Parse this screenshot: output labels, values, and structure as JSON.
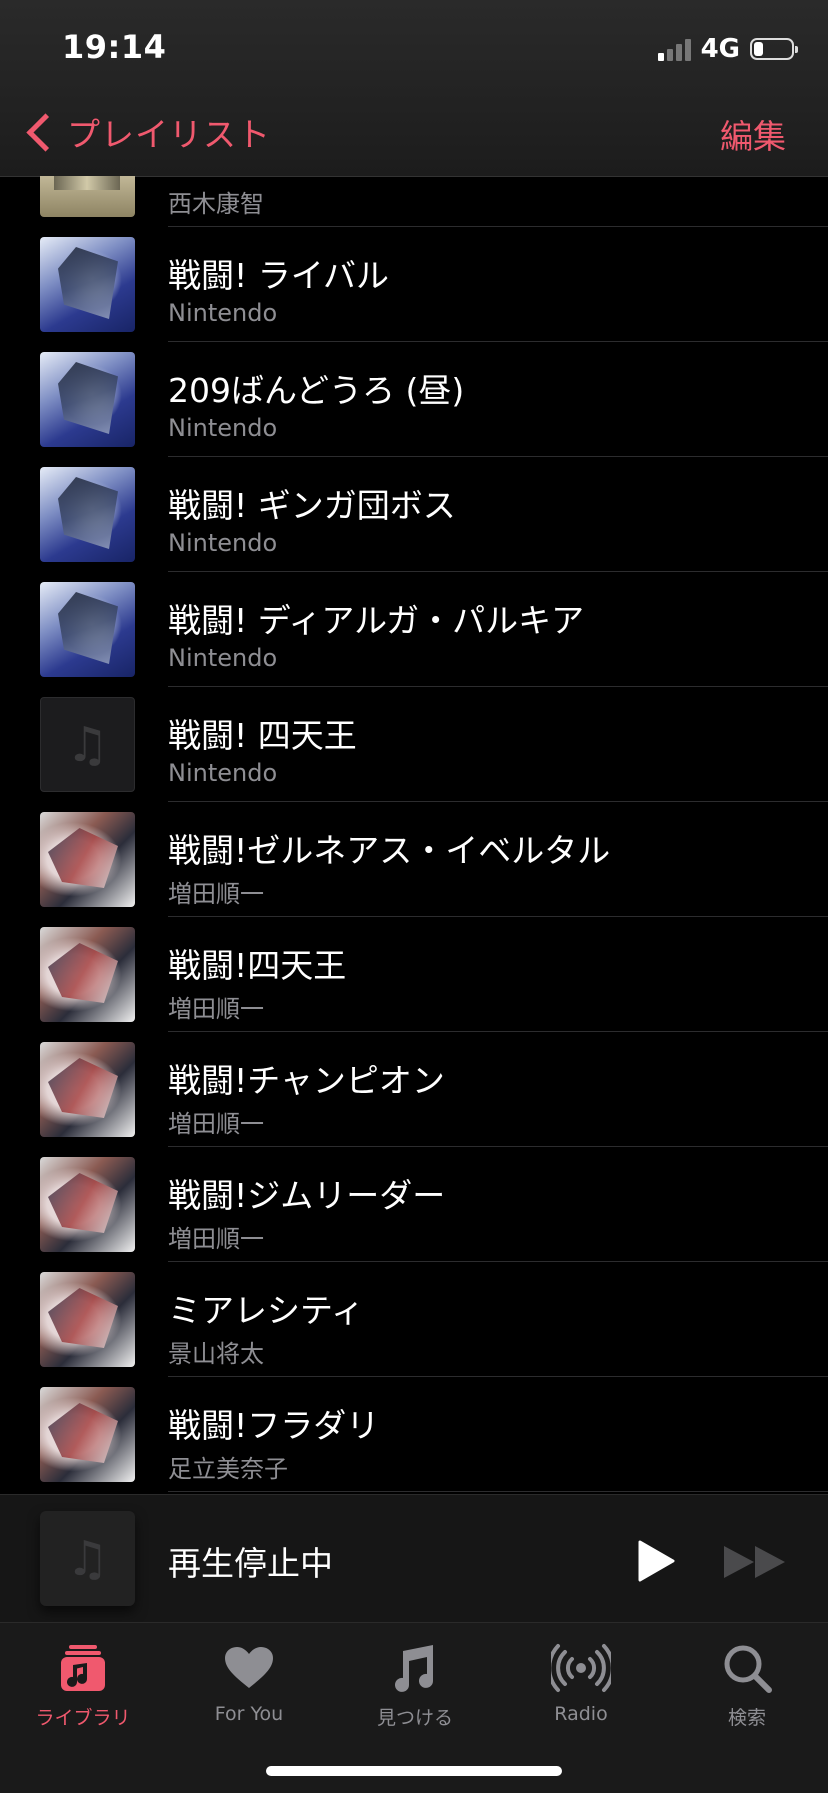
{
  "status": {
    "time": "19:14",
    "network": "4G",
    "battery_level": 0.25
  },
  "nav": {
    "back_label": "プレイリスト",
    "edit_label": "編集"
  },
  "tracks": [
    {
      "title": "",
      "artist": "西木康智",
      "art": "octo"
    },
    {
      "title": "戦闘! ライバル",
      "artist": "Nintendo",
      "art": "dialga"
    },
    {
      "title": "209ばんどうろ (昼)",
      "artist": "Nintendo",
      "art": "dialga"
    },
    {
      "title": "戦闘! ギンガ団ボス",
      "artist": "Nintendo",
      "art": "dialga"
    },
    {
      "title": "戦闘! ディアルガ・パルキア",
      "artist": "Nintendo",
      "art": "dialga"
    },
    {
      "title": "戦闘! 四天王",
      "artist": "Nintendo",
      "art": "empty"
    },
    {
      "title": "戦闘!ゼルネアス・イベルタル",
      "artist": "増田順一",
      "art": "xy"
    },
    {
      "title": "戦闘!四天王",
      "artist": "増田順一",
      "art": "xy"
    },
    {
      "title": "戦闘!チャンピオン",
      "artist": "増田順一",
      "art": "xy"
    },
    {
      "title": "戦闘!ジムリーダー",
      "artist": "増田順一",
      "art": "xy"
    },
    {
      "title": "ミアレシティ",
      "artist": "景山将太",
      "art": "xy"
    },
    {
      "title": "戦闘!フラダリ",
      "artist": "足立美奈子",
      "art": "xy"
    }
  ],
  "mini_player": {
    "title": "再生停止中"
  },
  "tabs": [
    {
      "label": "ライブラリ",
      "icon": "library-icon",
      "active": true
    },
    {
      "label": "For You",
      "icon": "heart-icon",
      "active": false
    },
    {
      "label": "見つける",
      "icon": "music-note-icon",
      "active": false
    },
    {
      "label": "Radio",
      "icon": "radio-icon",
      "active": false
    },
    {
      "label": "検索",
      "icon": "search-icon",
      "active": false
    }
  ],
  "colors": {
    "accent": "#f0596e",
    "secondary_text": "#8e8e93",
    "background": "#000000"
  }
}
